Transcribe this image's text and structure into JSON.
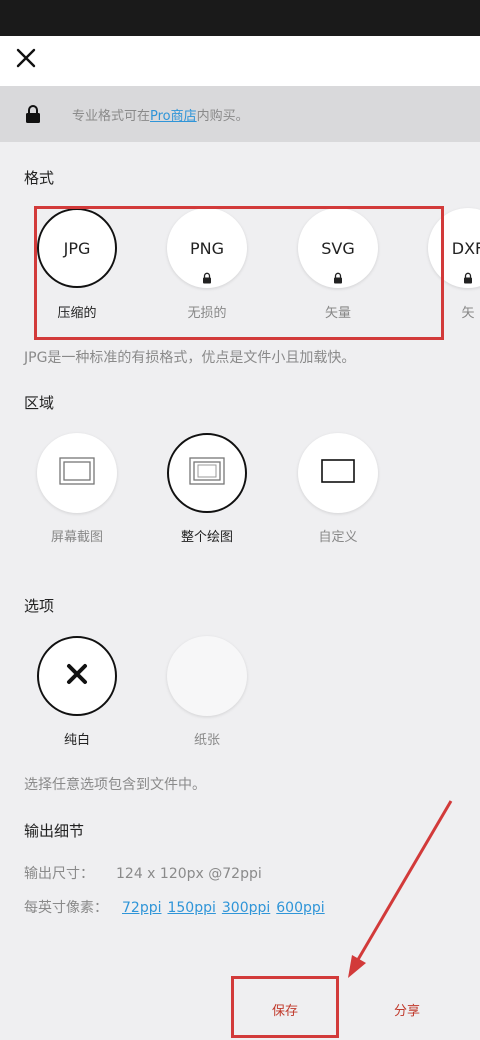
{
  "notice": {
    "prefix": "专业格式可在",
    "link": "Pro商店",
    "suffix": "内购买。"
  },
  "format_section": {
    "title": "格式",
    "items": [
      {
        "label": "JPG",
        "caption": "压缩的",
        "selected": true
      },
      {
        "label": "PNG",
        "caption": "无损的",
        "locked": true
      },
      {
        "label": "SVG",
        "caption": "矢量",
        "locked": true
      },
      {
        "label": "DXF",
        "caption": "矢",
        "locked": true
      }
    ],
    "description": "JPG是一种标准的有损格式，优点是文件小且加载快。"
  },
  "area_section": {
    "title": "区域",
    "items": [
      {
        "caption": "屏幕截图",
        "icon": "screen-frame-icon"
      },
      {
        "caption": "整个绘图",
        "icon": "full-canvas-icon",
        "selected": true
      },
      {
        "caption": "自定义",
        "icon": "custom-rect-icon"
      }
    ]
  },
  "options_section": {
    "title": "选项",
    "items": [
      {
        "caption": "纯白",
        "icon": "x-icon",
        "selected": true
      },
      {
        "caption": "纸张"
      }
    ],
    "description": "选择任意选项包含到文件中。"
  },
  "output_section": {
    "title": "输出细节",
    "size_label": "输出尺寸：",
    "size_value": "124 x 120px @72ppi",
    "ppi_label": "每英寸像素：",
    "ppi_options": [
      "72ppi",
      "150ppi",
      "300ppi",
      "600ppi"
    ]
  },
  "bottom": {
    "save": "保存",
    "share": "分享"
  },
  "colors": {
    "accent_link": "#2f95d8",
    "action_red": "#c0392b",
    "annotation_red": "#d23a3a"
  }
}
